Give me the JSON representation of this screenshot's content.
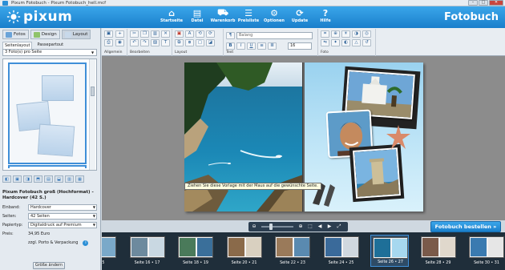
{
  "window": {
    "title": "Pixum Fotobuch - Pixum Fotobuch_hell.mcf"
  },
  "header": {
    "brand": "pixum",
    "app_title": "Fotobuch",
    "nav": [
      {
        "label": "Startseite",
        "icon": "home-icon",
        "glyph": "⌂"
      },
      {
        "label": "Datei",
        "icon": "file-icon",
        "glyph": "▤"
      },
      {
        "label": "Warenkorb",
        "icon": "cart-icon",
        "glyph": "⛟"
      },
      {
        "label": "Preisliste",
        "icon": "price-list-icon",
        "glyph": "☰"
      },
      {
        "label": "Optionen",
        "icon": "options-icon",
        "glyph": "⚙"
      },
      {
        "label": "Update",
        "icon": "update-icon",
        "glyph": "⟳"
      },
      {
        "label": "Hilfe",
        "icon": "help-icon",
        "glyph": "?"
      }
    ]
  },
  "left_panel": {
    "tabs": [
      {
        "label": "Fotos",
        "color": "#6aa3d8"
      },
      {
        "label": "Design",
        "color": "#8fc36a"
      },
      {
        "label": "Layout",
        "color": "#c8d9ea"
      }
    ],
    "subtabs": [
      "Seitenlayout",
      "Passepartout"
    ],
    "layout_select": "3 Foto(s) pro Seite",
    "tooltip": "Ziehen Sie diese Vorlage mit der Maus auf die gewünschte Seite.",
    "product": {
      "title": "Pixum Fotobuch groß (Hochformat) - Hardcover (42 S.)",
      "rows": [
        {
          "label": "Einband:",
          "value": "Hardcover"
        },
        {
          "label": "Seiten:",
          "value": "42 Seiten"
        },
        {
          "label": "Papiertyp:",
          "value": "Digitaldruck auf Premium"
        }
      ],
      "price_label": "Preis:",
      "price": "34,95 Euro",
      "shipping": "zzgl. Porto & Verpackung",
      "change_size": "Größe ändern"
    }
  },
  "toolbar": {
    "groups": [
      "Allgemein",
      "Bearbeiten",
      "Layout",
      "Text",
      "Foto"
    ],
    "font": "Balang",
    "size": "16",
    "text_bold": "B",
    "text_italic": "I",
    "text_underline": "U"
  },
  "order_button": "Fotobuch bestellen »",
  "pages": [
    {
      "label": "e • 15"
    },
    {
      "label": "Seite 16 • 17"
    },
    {
      "label": "Seite 18 • 19"
    },
    {
      "label": "Seite 20 • 21"
    },
    {
      "label": "Seite 22 • 23"
    },
    {
      "label": "Seite 24 • 25"
    },
    {
      "label": "Seite 26 • 27",
      "selected": true
    },
    {
      "label": "Seite 28 • 29"
    },
    {
      "label": "Seite 30 • 31"
    }
  ]
}
